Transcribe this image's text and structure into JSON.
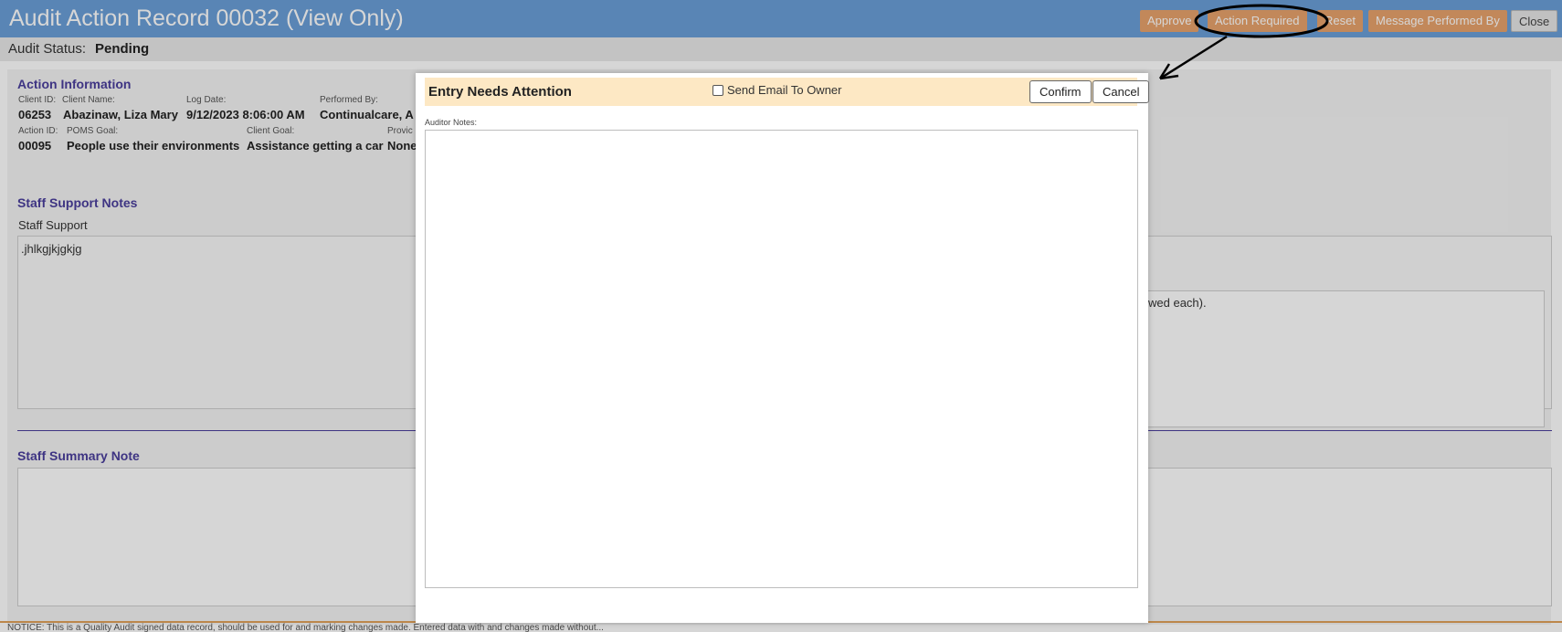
{
  "header": {
    "title": "Audit Action Record 00032 (View Only)",
    "buttons": {
      "approve": "Approve",
      "action_required": "Action Required",
      "reset": "Reset",
      "message_performed_by": "Message Performed By",
      "close": "Close"
    }
  },
  "status": {
    "label": "Audit Status:",
    "value": "Pending"
  },
  "action_info": {
    "title": "Action Information",
    "client_id_label": "Client ID:",
    "client_id": "06253",
    "client_name_label": "Client Name:",
    "client_name": "Abazinaw, Liza Mary",
    "log_date_label": "Log Date:",
    "log_date": "9/12/2023 8:06:00 AM",
    "performed_by_label": "Performed By:",
    "performed_by": "Continualcare, A",
    "action_id_label": "Action ID:",
    "action_id": "00095",
    "poms_goal_label": "POMS Goal:",
    "poms_goal": "People use their environments",
    "client_goal_label": "Client Goal:",
    "client_goal": "Assistance getting a car",
    "provider_label": "Provic",
    "provider": "None"
  },
  "staff_support": {
    "title": "Staff Support Notes",
    "subtitle": "Staff Support",
    "text": ".jhlkgjkjgkjg",
    "right_text": "wed each)."
  },
  "staff_summary": {
    "title": "Staff Summary Note"
  },
  "notice": "NOTICE: This is a Quality Audit signed data record, should be used for and marking changes made. Entered data with and changes made without...",
  "modal": {
    "title": "Entry Needs Attention",
    "send_email_label": "Send Email To Owner",
    "send_email_checked": false,
    "confirm": "Confirm",
    "cancel": "Cancel",
    "notes_label": "Auditor Notes:",
    "notes_value": ""
  },
  "colors": {
    "header_bg": "#6a9fd8",
    "action_button": "#e8a36c",
    "section_title": "#4a3f9c",
    "modal_header": "#fde8c4"
  }
}
